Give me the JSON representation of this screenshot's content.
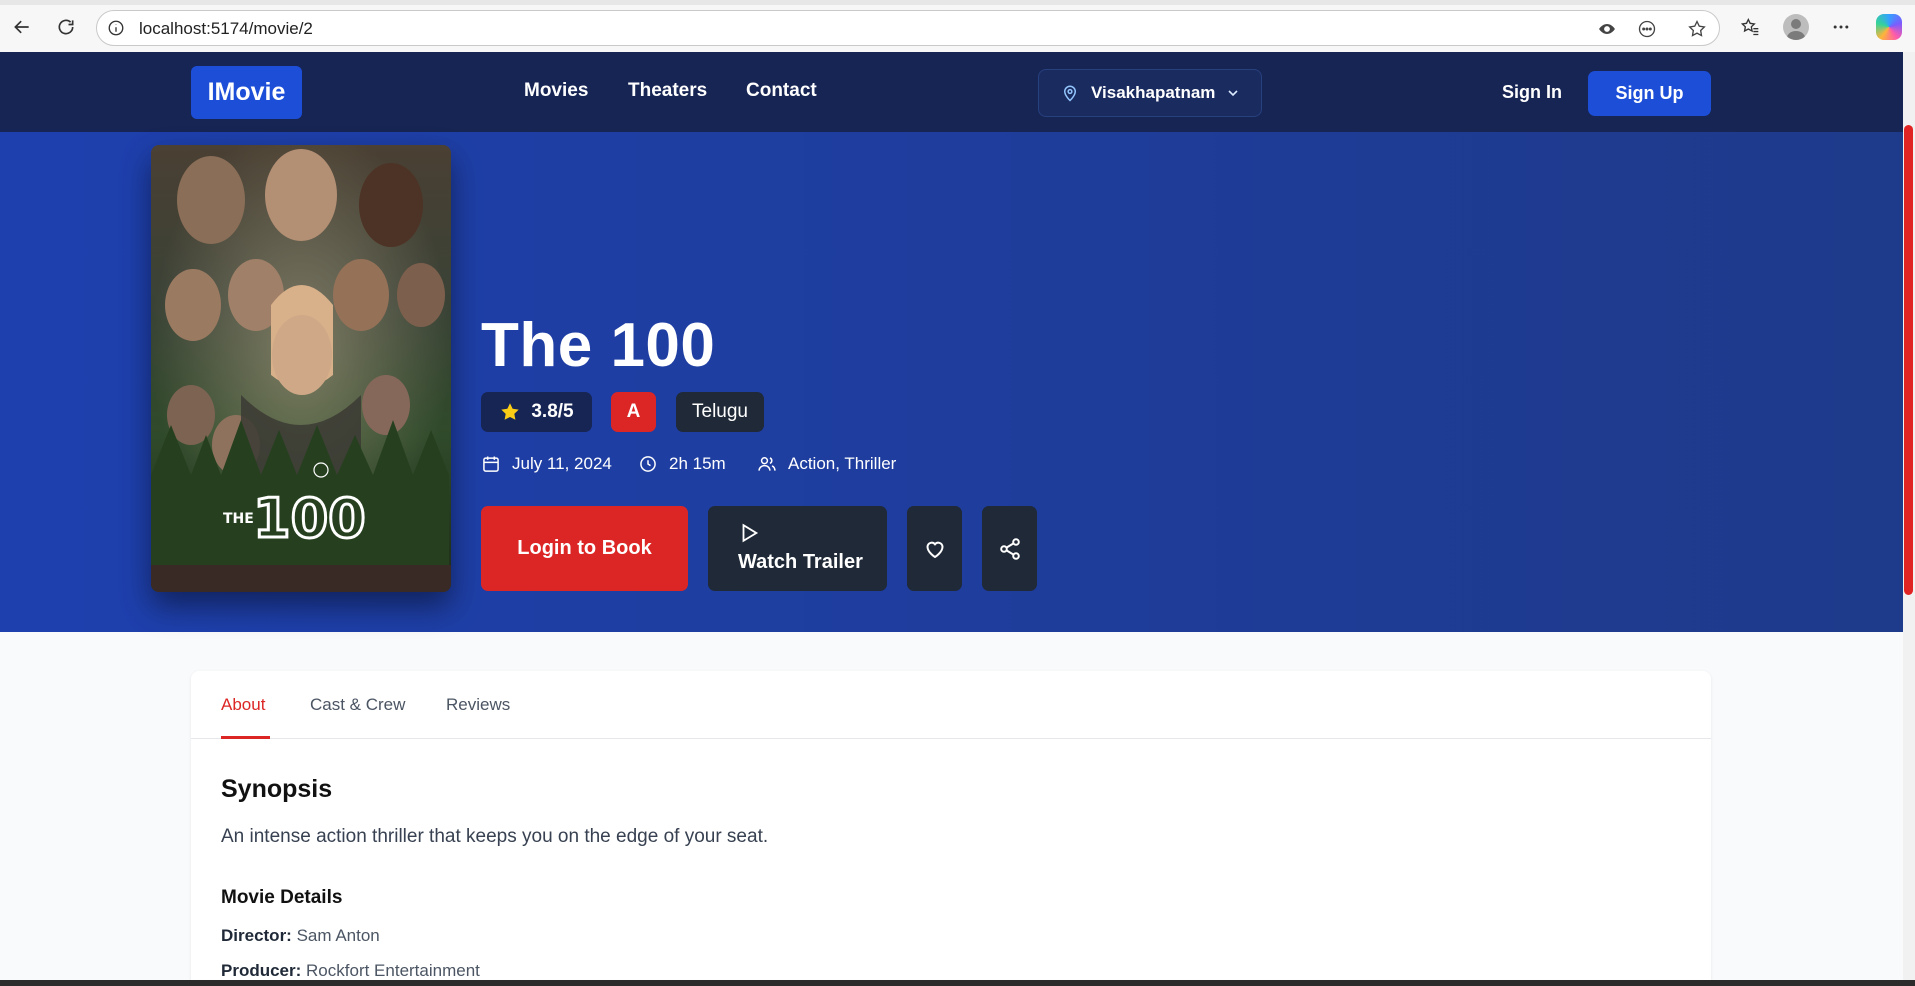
{
  "browser": {
    "url": "localhost:5174/movie/2"
  },
  "navbar": {
    "logo": "IMovie",
    "links": [
      "Movies",
      "Theaters",
      "Contact"
    ],
    "location": "Visakhapatnam",
    "sign_in": "Sign In",
    "sign_up": "Sign Up"
  },
  "movie": {
    "title": "The 100",
    "rating": "3.8/5",
    "certificate": "A",
    "language": "Telugu",
    "release_date": "July 11, 2024",
    "duration": "2h 15m",
    "genres": "Action, Thriller",
    "poster_title": "THE 100"
  },
  "actions": {
    "book": "Login to Book",
    "trailer": "Watch Trailer"
  },
  "tabs": [
    "About",
    "Cast & Crew",
    "Reviews"
  ],
  "active_tab": "About",
  "about": {
    "synopsis_title": "Synopsis",
    "synopsis": "An intense action thriller that keeps you on the edge of your seat.",
    "details_title": "Movie Details",
    "details": [
      {
        "key": "Director:",
        "value": "Sam Anton"
      },
      {
        "key": "Producer:",
        "value": "Rockfort Entertainment"
      }
    ]
  },
  "colors": {
    "navbar": "#172554",
    "hero_start": "#1e40af",
    "hero_end": "#1e3a8a",
    "accent_red": "#dc2626",
    "primary_blue": "#1d4ed8",
    "dark_button": "#1f2937",
    "star": "#facc15"
  }
}
